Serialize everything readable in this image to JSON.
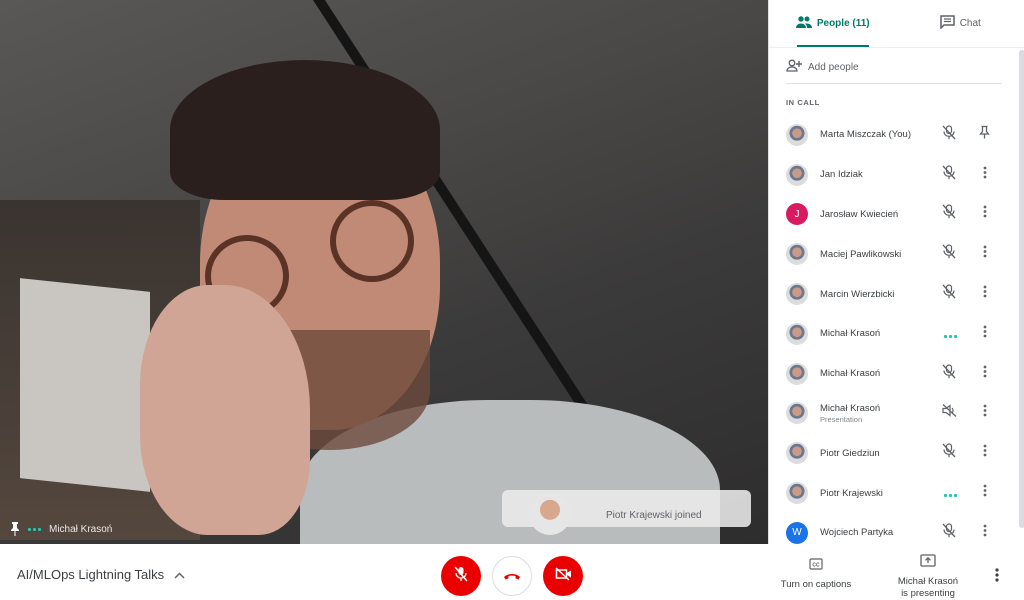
{
  "stage": {
    "main_participant": "Michał Krasoń",
    "toast": "Piotr Krajewski joined"
  },
  "colors": {
    "accent": "#00796b",
    "danger": "#ea0000",
    "speaking": "#1ec8b0",
    "avatar_j": "#d81b60",
    "avatar_w": "#1a73e8"
  },
  "bottom": {
    "meeting_title": "AI/MLOps Lightning Talks",
    "captions_label": "Turn on captions",
    "presenting_line1": "Michał Krasoń",
    "presenting_line2": "is presenting"
  },
  "panel": {
    "tabs": [
      {
        "label": "People (11)",
        "icon": "people-icon"
      },
      {
        "label": "Chat",
        "icon": "chat-icon"
      }
    ],
    "add_people": "Add people",
    "section_title": "IN CALL",
    "participants": [
      {
        "name": "Marta Miszczak (You)",
        "sub": "",
        "status": "muted",
        "action": "pin"
      },
      {
        "name": "Jan Idziak",
        "sub": "",
        "status": "muted",
        "action": "more"
      },
      {
        "name": "Jarosław Kwiecień",
        "sub": "",
        "status": "muted",
        "action": "more",
        "initial": "J"
      },
      {
        "name": "Maciej Pawlikowski",
        "sub": "",
        "status": "muted",
        "action": "more"
      },
      {
        "name": "Marcin Wierzbicki",
        "sub": "",
        "status": "muted",
        "action": "more"
      },
      {
        "name": "Michał Krasoń",
        "sub": "",
        "status": "speaking",
        "action": "more"
      },
      {
        "name": "Michał Krasoń",
        "sub": "",
        "status": "muted",
        "action": "more"
      },
      {
        "name": "Michał Krasoń",
        "sub": "Presentation",
        "status": "audio-off",
        "action": "more"
      },
      {
        "name": "Piotr Giedziun",
        "sub": "",
        "status": "muted",
        "action": "more"
      },
      {
        "name": "Piotr Krajewski",
        "sub": "",
        "status": "speaking",
        "action": "more"
      },
      {
        "name": "Wojciech Partyka",
        "sub": "",
        "status": "muted",
        "action": "more",
        "initial": "W"
      }
    ]
  }
}
